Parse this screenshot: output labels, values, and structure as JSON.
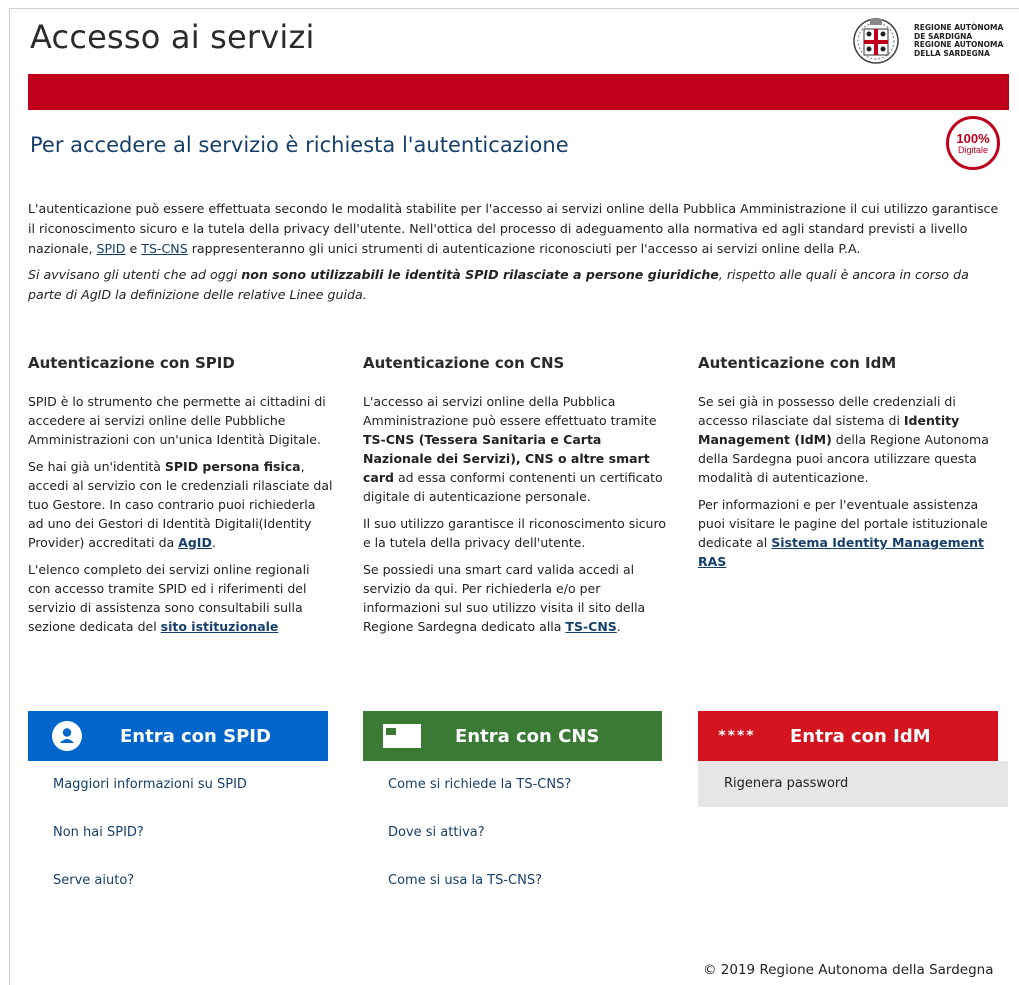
{
  "header": {
    "title": "Accesso ai servizi",
    "logo_line1": "REGIONE AUTÒNOMA",
    "logo_line2": "DE SARDIGNA",
    "logo_line3": "REGIONE AUTONOMA",
    "logo_line4": "DELLA SARDEGNA",
    "brand_color": "#c0001a"
  },
  "auth": {
    "heading": "Per accedere al servizio è richiesta l'autenticazione",
    "badge_num": "100%",
    "badge_label": "Digitale"
  },
  "intro": {
    "p1_a": "L'autenticazione può essere effettuata secondo le modalità stabilite per l'accesso ai servizi online della Pubblica Amministrazione il cui utilizzo garantisce il riconoscimento sicuro e la tutela della privacy dell'utente. Nell'ottica del processo di adeguamento alla normativa ed agli standard previsti a livello nazionale, ",
    "p1_link1": "SPID",
    "p1_b": " e ",
    "p1_link2": "TS-CNS",
    "p1_c": " rappresenteranno gli unici strumenti di autenticazione riconosciuti per l'accesso ai servizi online della P.A.",
    "p2_a": "Si avvisano gli utenti che ad oggi ",
    "p2_bold": "non sono utilizzabili le identità SPID rilasciate a persone giuridiche",
    "p2_b": ", rispetto alle quali è ancora in corso da parte di AgID la definizione delle relative Linee guida."
  },
  "spid": {
    "heading": "Autenticazione con SPID",
    "p1": "SPID è lo strumento che permette ai cittadini di accedere ai servizi online delle Pubbliche Amministrazioni con un'unica Identità Digitale.",
    "p2_a": "Se hai già un'identità ",
    "p2_bold": "SPID persona fisica",
    "p2_b": ", accedi al servizio con le credenziali rilasciate dal tuo Gestore. In caso contrario puoi richiederla ad uno dei Gestori di Identità Digitali(Identity Provider) accreditati da ",
    "p2_link": "AgID",
    "p2_c": ".",
    "p3_a": "L'elenco completo dei servizi online regionali con accesso tramite SPID ed i riferimenti del servizio di assistenza sono consultabili sulla sezione dedicata del ",
    "p3_link": "sito istituzionale",
    "button": "Entra con SPID",
    "links": [
      "Maggiori informazioni su SPID",
      "Non hai SPID?",
      "Serve aiuto?"
    ],
    "color": "#0066cc"
  },
  "cns": {
    "heading": "Autenticazione con CNS",
    "p1_a": "L'accesso ai servizi online della Pubblica Amministrazione può essere effettuato tramite ",
    "p1_bold": "TS-CNS (Tessera Sanitaria e Carta Nazionale dei Servizi), CNS o altre smart card",
    "p1_b": " ad essa conformi contenenti un certificato digitale di autenticazione personale.",
    "p2": "Il suo utilizzo garantisce il riconoscimento sicuro e la tutela della privacy dell'utente.",
    "p3_a": "Se possiedi una smart card valida accedi al servizio da qui. Per richiederla e/o per informazioni sul suo utilizzo visita il sito della Regione Sardegna dedicato alla ",
    "p3_link": "TS-CNS",
    "p3_b": ".",
    "button": "Entra con CNS",
    "links": [
      "Come si richiede la TS-CNS?",
      "Dove si attiva?",
      "Come si usa la TS-CNS?"
    ],
    "color": "#3a7a35"
  },
  "idm": {
    "heading": "Autenticazione con IdM",
    "p1_a": "Se sei già in possesso delle credenziali di accesso rilasciate dal sistema di ",
    "p1_bold": "Identity Management (IdM)",
    "p1_b": " della Regione Autonoma della Sardegna puoi ancora utilizzare questa modalità di autenticazione.",
    "p2_a": "Per informazioni e per l'eventuale assistenza puoi visitare le pagine del portale istituzionale dedicate al ",
    "p2_link": "Sistema Identity Management RAS",
    "button": "Entra con IdM",
    "button_icon": "****",
    "regen": "Rigenera password",
    "color": "#d4141e"
  },
  "footer": {
    "text": "© 2019 Regione Autonoma della Sardegna"
  }
}
